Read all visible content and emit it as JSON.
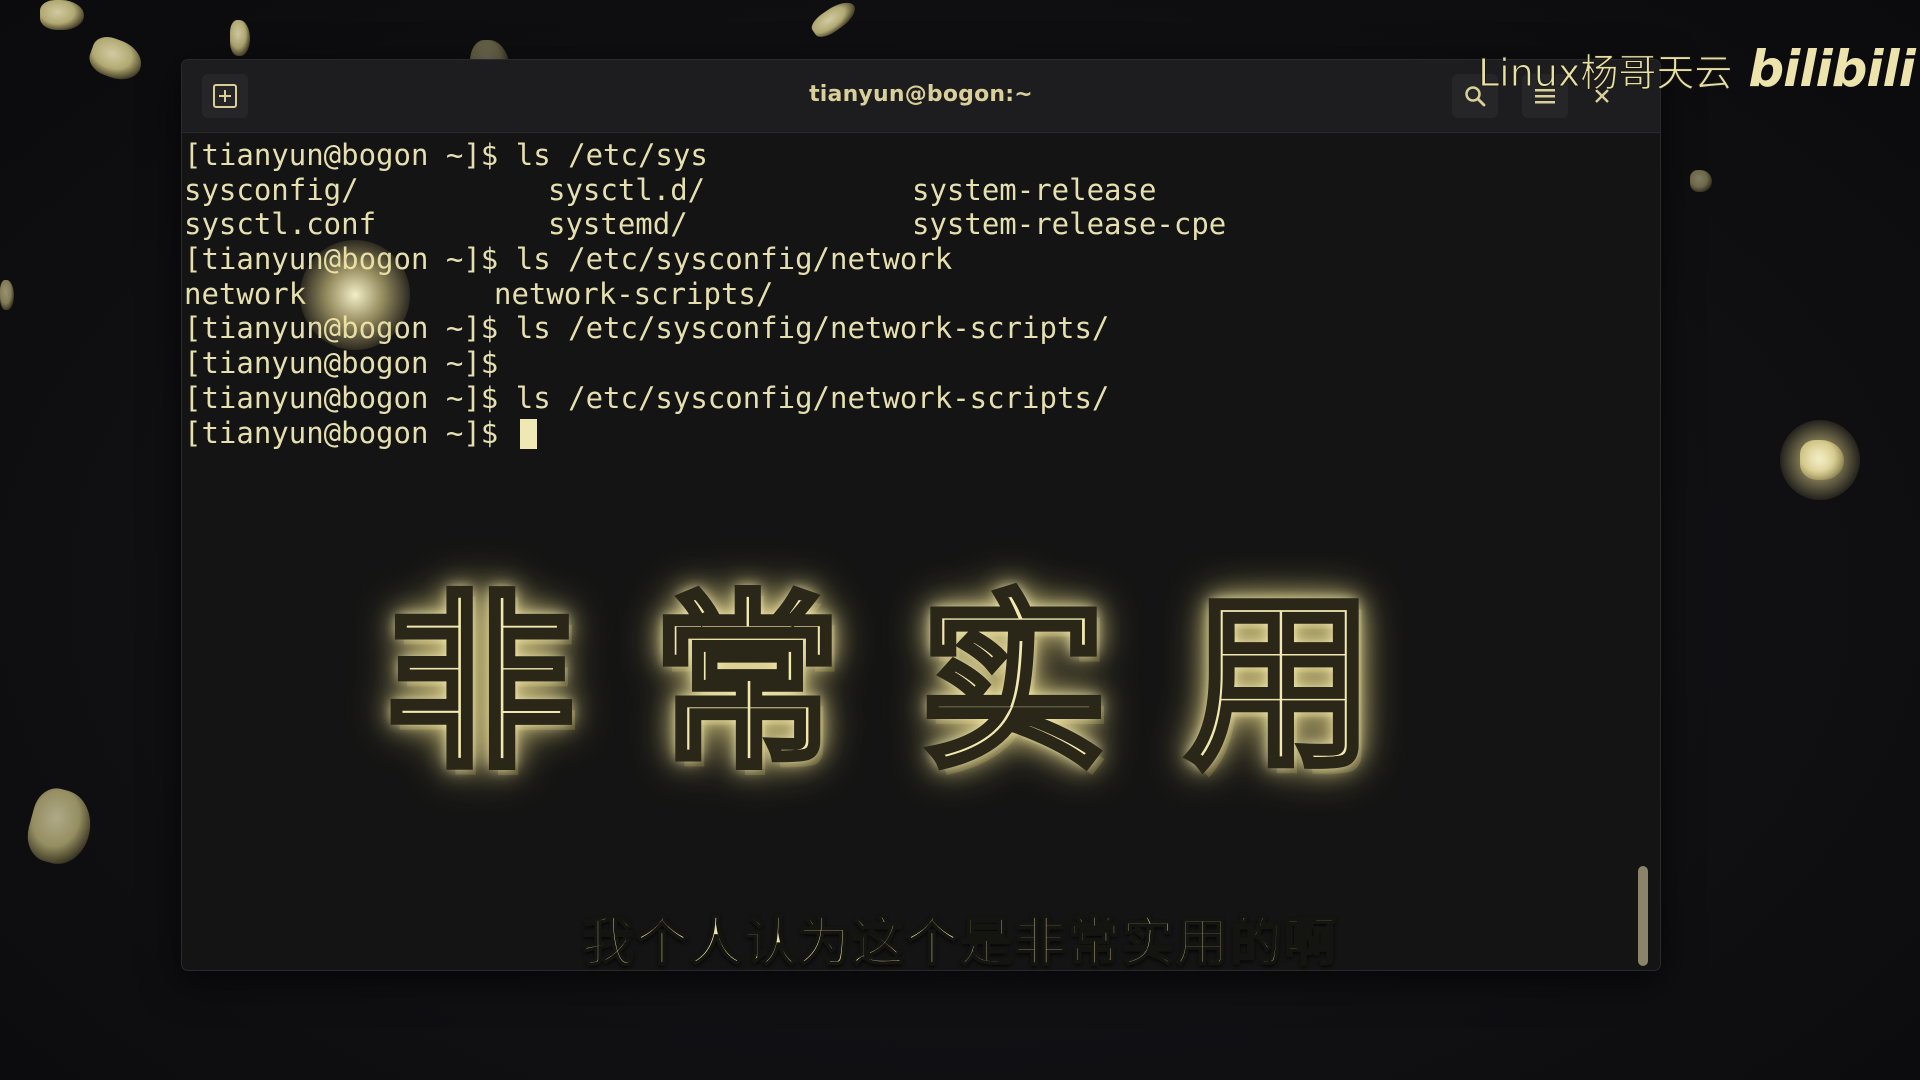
{
  "window": {
    "title": "tianyun@bogon:~",
    "icons": {
      "new_tab": "new-tab-icon",
      "search": "search-icon",
      "menu": "hamburger-menu-icon",
      "close": "close-icon"
    }
  },
  "terminal": {
    "lines": [
      {
        "prompt": "[tianyun@bogon ~]$ ",
        "command": "ls /etc/sys"
      },
      {
        "cols": [
          "sysconfig/",
          "sysctl.d/",
          "system-release"
        ]
      },
      {
        "cols": [
          "sysctl.conf",
          "systemd/",
          "system-release-cpe"
        ]
      },
      {
        "prompt": "[tianyun@bogon ~]$ ",
        "command": "ls /etc/sysconfig/network"
      },
      {
        "cols": [
          "network",
          "network-scripts/"
        ]
      },
      {
        "prompt": "[tianyun@bogon ~]$ ",
        "command": "ls /etc/sysconfig/network-scripts/"
      },
      {
        "prompt": "[tianyun@bogon ~]$",
        "command": ""
      },
      {
        "prompt": "[tianyun@bogon ~]$ ",
        "command": "ls /etc/sysconfig/network-scripts/"
      },
      {
        "prompt": "[tianyun@bogon ~]$ ",
        "command": ""
      }
    ]
  },
  "overlay": {
    "big_title": [
      "非",
      "常",
      "实",
      "用"
    ],
    "subtitle": "我个人认为这个是非常实用的啊",
    "watermark_text": "Linux杨哥天云",
    "watermark_logo": "bilibili"
  },
  "colors": {
    "terminal_text": "#e6dfb0",
    "terminal_bg": "#141414",
    "titlebar_bg": "#1d1d1f",
    "accent_glow": "#f1e9b0"
  }
}
